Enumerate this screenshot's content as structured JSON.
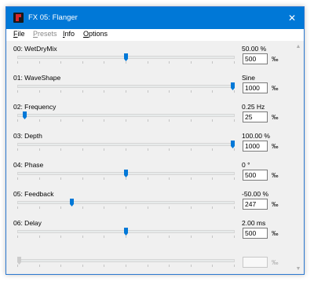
{
  "window": {
    "title": "FX 05: Flanger",
    "close_glyph": "✕",
    "accent_color": "#0078d7"
  },
  "menu": [
    {
      "label": "File",
      "enabled": true
    },
    {
      "label": "Presets",
      "enabled": false
    },
    {
      "label": "Info",
      "enabled": true
    },
    {
      "label": "Options",
      "enabled": true
    }
  ],
  "params": [
    {
      "name": "00: WetDryMix",
      "display": "50.00 %",
      "raw": "500",
      "unit": "‰",
      "level": 0.5
    },
    {
      "name": "01: WaveShape",
      "display": "Sine",
      "raw": "1000",
      "unit": "‰",
      "level": 1.0
    },
    {
      "name": "02: Frequency",
      "display": "0.25 Hz",
      "raw": "25",
      "unit": "‰",
      "level": 0.025
    },
    {
      "name": "03: Depth",
      "display": "100.00 %",
      "raw": "1000",
      "unit": "‰",
      "level": 1.0
    },
    {
      "name": "04: Phase",
      "display": "0 °",
      "raw": "500",
      "unit": "‰",
      "level": 0.5
    },
    {
      "name": "05: Feedback",
      "display": "-50.00 %",
      "raw": "247",
      "unit": "‰",
      "level": 0.247
    },
    {
      "name": "06: Delay",
      "display": "2.00 ms",
      "raw": "500",
      "unit": "‰",
      "level": 0.5
    }
  ],
  "empty_row": {
    "unit": "‰",
    "level": 0.0
  },
  "scrollbar": {
    "up_glyph": "▲",
    "down_glyph": "▼"
  }
}
